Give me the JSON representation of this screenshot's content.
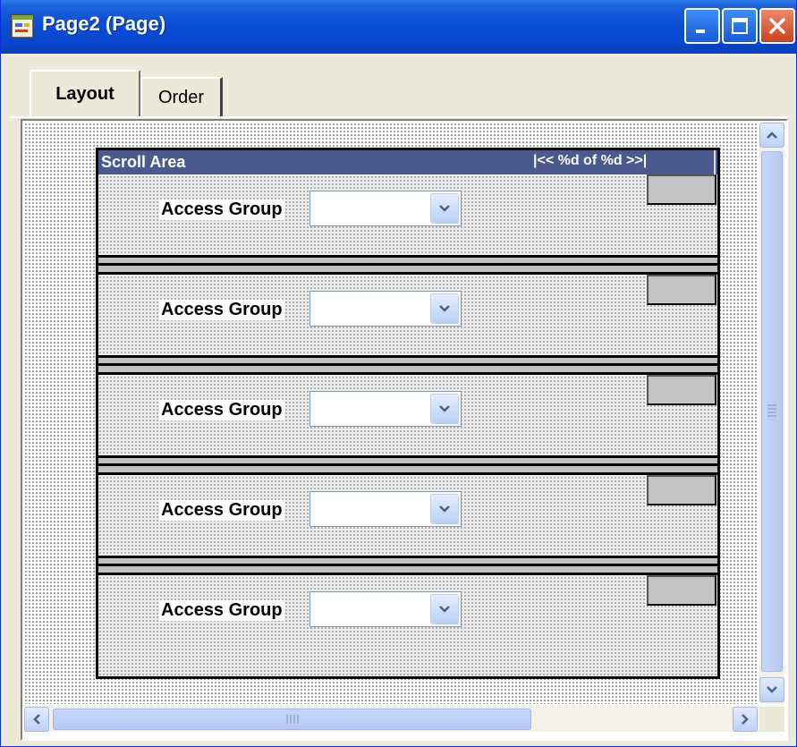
{
  "window": {
    "title": "Page2 (Page)",
    "icon": "page-definition-icon",
    "controls": [
      "minimize-icon",
      "maximize-icon",
      "close-icon"
    ]
  },
  "tabs": [
    {
      "label": "Layout",
      "active": true
    },
    {
      "label": "Order",
      "active": false
    }
  ],
  "scroll_area": {
    "title": "Scroll Area",
    "nav": "|<< %d of %d >>|",
    "rows": [
      {
        "label": "Access Group",
        "value": ""
      },
      {
        "label": "Access Group",
        "value": ""
      },
      {
        "label": "Access Group",
        "value": ""
      },
      {
        "label": "Access Group",
        "value": ""
      },
      {
        "label": "Access Group",
        "value": ""
      }
    ]
  },
  "colors": {
    "titlebar": "#0a4fd4",
    "scroll_header": "#4b5a8c",
    "close_button": "#c8401e"
  }
}
